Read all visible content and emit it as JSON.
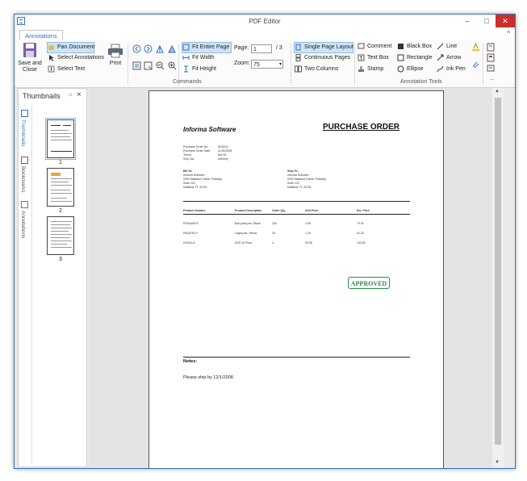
{
  "window": {
    "title": "PDF Editor",
    "min_label": "–",
    "max_label": "□",
    "close_label": "✕"
  },
  "ribbon": {
    "tab": "Annotations",
    "collapse_label": "^",
    "save_label": "Save and Close",
    "pan_document": "Pan Document",
    "select_annotations": "Select Annotations",
    "select_text": "Select Text",
    "print": "Print",
    "fit_entire_page": "Fit Entire Page",
    "fit_width": "Fit Width",
    "fit_height": "Fit Height",
    "page_label": "Page:",
    "page_value": "1",
    "page_total": "/ 3",
    "zoom_label": "Zoom:",
    "zoom_value": "75",
    "single_page": "Single Page Layout",
    "continuous": "Continuous Pages",
    "two_columns": "Two Columns",
    "comment": "Comment",
    "text_box": "Text Box",
    "stamp": "Stamp",
    "black_box": "Black Box",
    "rectangle": "Rectangle",
    "ellipse": "Ellipse",
    "line": "Line",
    "arrow": "Arrow",
    "ink_pen": "Ink Pen",
    "commands_group": "Commands",
    "annotation_tools_group": "Annotation Tools",
    "more_label": "..."
  },
  "panel": {
    "title": "Thumbnails",
    "pin": "⌂",
    "close": "×",
    "tabs": [
      "Thumbnails",
      "Bookmarks",
      "Annotations"
    ],
    "thumbs": [
      "1",
      "2",
      "3"
    ]
  },
  "document": {
    "company": "Informa Software",
    "heading": "PURCHASE ORDER",
    "meta_labels": [
      "Purchase Order No:",
      "Purchase Order Date:",
      "Terms:",
      "Ship Via:"
    ],
    "meta_values": [
      "AD3224",
      "11/30/2008",
      "Net 30",
      "Delivery"
    ],
    "bill_to_label": "Bill To:",
    "bill_to": [
      "Informa Software",
      "2300 Maitland Center Parkway",
      "Suite 220",
      "Maitland, FL  32751"
    ],
    "ship_to_label": "Ship To:",
    "ship_to": [
      "Informa Software",
      "2300 Maitland Center Parkway",
      "Suite 220",
      "Maitland, FL  32751"
    ],
    "columns": [
      "Product Number",
      "Product Description",
      "Order Qty.",
      "Unit Price",
      "Ext. Price"
    ],
    "rows": [
      [
        "PEN3406-R",
        "Ball point pen, Black",
        "200",
        "3.95",
        "79.00"
      ],
      [
        "PAD8793-Y",
        "Legal pad, Yellow",
        "25",
        "1.25",
        "31.25"
      ],
      [
        "DVD4211",
        "DVD 10 Pack",
        "4",
        "25.95",
        "103.80"
      ]
    ],
    "stamp": "APPROVED",
    "notes_label": "Notes:",
    "notes": "Please ship by 12/1/2008."
  },
  "colors": {
    "accent": "#2b73c6",
    "close": "#c8312b",
    "stamp": "#2e8b4a",
    "highlight": "#cde4f7"
  }
}
